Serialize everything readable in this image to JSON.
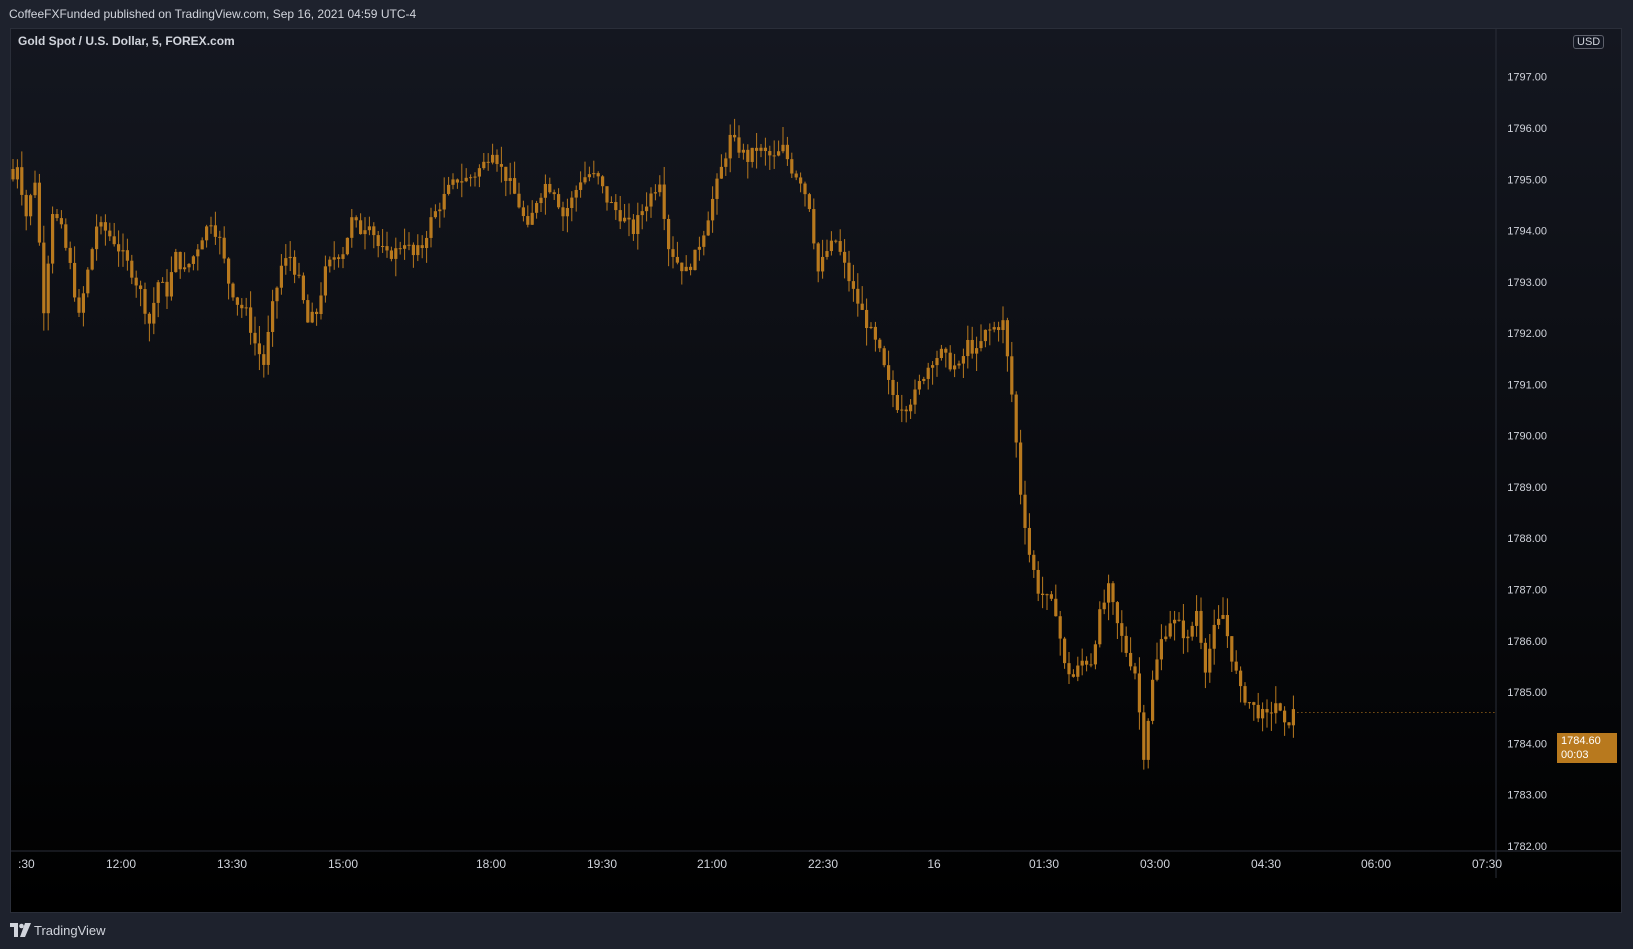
{
  "header": {
    "publisher_line": "CoffeeFXFunded published on TradingView.com, Sep 16, 2021 04:59 UTC-4"
  },
  "symbol": {
    "title": "Gold Spot / U.S. Dollar, 5, FOREX.com",
    "currency": "USD"
  },
  "last_price": {
    "price": "1784.60",
    "countdown": "00:03"
  },
  "footer": {
    "brand": "TradingView"
  },
  "colors": {
    "candle": "#b8791e",
    "background_top": "#141720",
    "background_bottom": "#000000",
    "axis_text": "#d1d4dc"
  },
  "chart_data": {
    "type": "candlestick",
    "title": "Gold Spot / U.S. Dollar, 5, FOREX.com",
    "xlabel": "",
    "ylabel": "",
    "ylim": [
      1781.9,
      1797.95
    ],
    "y_ticks": [
      1782.0,
      1783.0,
      1784.0,
      1785.0,
      1786.0,
      1787.0,
      1788.0,
      1789.0,
      1790.0,
      1791.0,
      1792.0,
      1793.0,
      1794.0,
      1795.0,
      1796.0,
      1797.0
    ],
    "x_tick_labels": [
      ":30",
      "12:00",
      "13:30",
      "15:00",
      "18:00",
      "19:30",
      "21:00",
      "22:30",
      "16",
      "01:30",
      "03:00",
      "04:30",
      "06:00",
      "07:30"
    ],
    "close_path": [
      [
        0,
        1795.0
      ],
      [
        1,
        1795.3
      ],
      [
        3,
        1794.3
      ],
      [
        5,
        1795.0
      ],
      [
        7,
        1792.5
      ],
      [
        9,
        1794.4
      ],
      [
        11,
        1794.0
      ],
      [
        13,
        1793.3
      ],
      [
        15,
        1792.3
      ],
      [
        17,
        1793.2
      ],
      [
        19,
        1794.1
      ],
      [
        21,
        1794.0
      ],
      [
        23,
        1793.8
      ],
      [
        25,
        1793.5
      ],
      [
        27,
        1793.2
      ],
      [
        29,
        1792.8
      ],
      [
        31,
        1792.2
      ],
      [
        33,
        1793.0
      ],
      [
        35,
        1792.8
      ],
      [
        37,
        1793.5
      ],
      [
        39,
        1793.2
      ],
      [
        41,
        1793.5
      ],
      [
        43,
        1793.9
      ],
      [
        45,
        1794.2
      ],
      [
        47,
        1793.8
      ],
      [
        49,
        1793.0
      ],
      [
        51,
        1792.6
      ],
      [
        53,
        1792.4
      ],
      [
        55,
        1791.8
      ],
      [
        57,
        1791.4
      ],
      [
        59,
        1792.5
      ],
      [
        61,
        1793.3
      ],
      [
        63,
        1793.5
      ],
      [
        65,
        1793.0
      ],
      [
        67,
        1792.2
      ],
      [
        69,
        1792.4
      ],
      [
        71,
        1793.2
      ],
      [
        73,
        1793.5
      ],
      [
        75,
        1793.6
      ],
      [
        77,
        1794.2
      ],
      [
        79,
        1794.0
      ],
      [
        81,
        1794.2
      ],
      [
        83,
        1793.7
      ],
      [
        85,
        1793.5
      ],
      [
        87,
        1793.6
      ],
      [
        89,
        1793.8
      ],
      [
        91,
        1793.5
      ],
      [
        93,
        1793.7
      ],
      [
        95,
        1794.2
      ],
      [
        97,
        1794.5
      ],
      [
        99,
        1794.8
      ],
      [
        101,
        1795.0
      ],
      [
        103,
        1795.0
      ],
      [
        105,
        1795.1
      ],
      [
        107,
        1795.3
      ],
      [
        109,
        1795.6
      ],
      [
        111,
        1795.2
      ],
      [
        113,
        1794.9
      ],
      [
        115,
        1794.5
      ],
      [
        117,
        1794.0
      ],
      [
        119,
        1794.6
      ],
      [
        121,
        1794.9
      ],
      [
        123,
        1794.8
      ],
      [
        125,
        1794.3
      ],
      [
        127,
        1794.6
      ],
      [
        129,
        1795.0
      ],
      [
        131,
        1795.1
      ],
      [
        133,
        1795.0
      ],
      [
        135,
        1794.6
      ],
      [
        137,
        1794.4
      ],
      [
        139,
        1794.2
      ],
      [
        141,
        1794.0
      ],
      [
        143,
        1794.4
      ],
      [
        145,
        1794.7
      ],
      [
        147,
        1795.0
      ],
      [
        149,
        1793.7
      ],
      [
        151,
        1793.4
      ],
      [
        153,
        1793.2
      ],
      [
        155,
        1793.5
      ],
      [
        157,
        1794.0
      ],
      [
        159,
        1794.6
      ],
      [
        161,
        1795.2
      ],
      [
        163,
        1795.8
      ],
      [
        165,
        1795.6
      ],
      [
        167,
        1795.4
      ],
      [
        169,
        1795.6
      ],
      [
        171,
        1795.5
      ],
      [
        173,
        1795.4
      ],
      [
        175,
        1795.6
      ],
      [
        177,
        1795.2
      ],
      [
        179,
        1795.0
      ],
      [
        181,
        1794.5
      ],
      [
        183,
        1793.2
      ],
      [
        185,
        1793.6
      ],
      [
        187,
        1793.8
      ],
      [
        189,
        1793.3
      ],
      [
        191,
        1792.8
      ],
      [
        193,
        1792.4
      ],
      [
        195,
        1792.0
      ],
      [
        197,
        1791.6
      ],
      [
        199,
        1791.0
      ],
      [
        201,
        1790.6
      ],
      [
        203,
        1790.6
      ],
      [
        205,
        1790.8
      ],
      [
        207,
        1791.2
      ],
      [
        209,
        1791.5
      ],
      [
        211,
        1791.6
      ],
      [
        213,
        1791.4
      ],
      [
        215,
        1791.3
      ],
      [
        217,
        1791.8
      ],
      [
        219,
        1791.6
      ],
      [
        221,
        1792.0
      ],
      [
        223,
        1792.1
      ],
      [
        225,
        1792.2
      ],
      [
        227,
        1790.8
      ],
      [
        229,
        1788.9
      ],
      [
        231,
        1787.7
      ],
      [
        233,
        1787.0
      ],
      [
        235,
        1786.8
      ],
      [
        237,
        1786.6
      ],
      [
        239,
        1785.5
      ],
      [
        241,
        1785.3
      ],
      [
        243,
        1785.6
      ],
      [
        245,
        1785.6
      ],
      [
        247,
        1786.5
      ],
      [
        249,
        1787.0
      ],
      [
        251,
        1786.3
      ],
      [
        253,
        1785.8
      ],
      [
        255,
        1785.4
      ],
      [
        257,
        1783.8
      ],
      [
        259,
        1785.2
      ],
      [
        261,
        1786.0
      ],
      [
        263,
        1786.4
      ],
      [
        265,
        1786.3
      ],
      [
        267,
        1786.0
      ],
      [
        269,
        1786.6
      ],
      [
        271,
        1785.5
      ],
      [
        273,
        1786.2
      ],
      [
        275,
        1786.5
      ],
      [
        277,
        1785.7
      ],
      [
        279,
        1785.0
      ],
      [
        281,
        1784.8
      ],
      [
        283,
        1784.6
      ],
      [
        285,
        1784.5
      ],
      [
        287,
        1784.8
      ],
      [
        289,
        1784.3
      ],
      [
        291,
        1784.6
      ]
    ],
    "last_bar_index": 291
  }
}
